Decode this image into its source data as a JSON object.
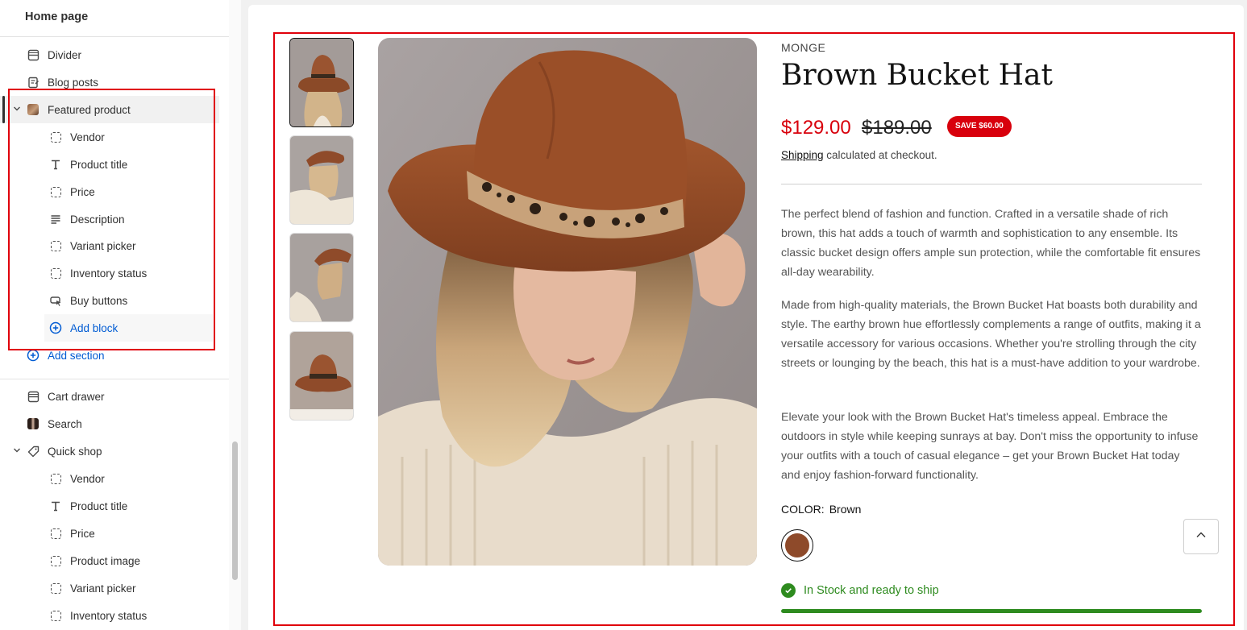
{
  "sidebar": {
    "header": "Home page",
    "items": [
      {
        "label": "Divider"
      },
      {
        "label": "Blog posts"
      },
      {
        "label": "Featured product"
      },
      {
        "label": "Vendor"
      },
      {
        "label": "Product title"
      },
      {
        "label": "Price"
      },
      {
        "label": "Description"
      },
      {
        "label": "Variant picker"
      },
      {
        "label": "Inventory status"
      },
      {
        "label": "Buy buttons"
      },
      {
        "label": "Add block"
      },
      {
        "label": "Add section"
      },
      {
        "label": "Cart drawer"
      },
      {
        "label": "Search"
      },
      {
        "label": "Quick shop"
      },
      {
        "label": "Vendor"
      },
      {
        "label": "Product title"
      },
      {
        "label": "Price"
      },
      {
        "label": "Product image"
      },
      {
        "label": "Variant picker"
      },
      {
        "label": "Inventory status"
      }
    ]
  },
  "product": {
    "vendor": "MONGE",
    "title": "Brown Bucket Hat",
    "price": "$129.00",
    "compare_price": "$189.00",
    "save_badge": "SAVE $60.00",
    "shipping_link": "Shipping",
    "shipping_text": " calculated at checkout.",
    "description": [
      "The perfect blend of fashion and function. Crafted in a versatile shade of rich brown, this hat adds a touch of warmth and sophistication to any ensemble. Its classic bucket design offers ample sun protection, while the comfortable fit ensures all-day wearability.",
      "Made from high-quality materials, the Brown Bucket Hat boasts both durability and style. The earthy brown hue effortlessly complements a range of outfits, making it a versatile accessory for various occasions. Whether you're strolling through the city streets or lounging by the beach, this hat is a must-have addition to your wardrobe.",
      "Elevate your look with the Brown Bucket Hat's timeless appeal. Embrace the outdoors in style while keeping sunrays at bay. Don't miss the opportunity to infuse your outfits with a touch of casual elegance – get your Brown Bucket Hat today and enjoy fashion-forward functionality."
    ],
    "color_label": "COLOR:",
    "color_value": "Brown",
    "swatch_color": "#8e4a2a",
    "stock_text": "In Stock and ready to ship",
    "stock_level": 1.0
  },
  "colors": {
    "highlight": "#e0000b",
    "sale": "#d8000c",
    "link_blue": "#005bd3",
    "stock_green": "#2e8b1f"
  }
}
